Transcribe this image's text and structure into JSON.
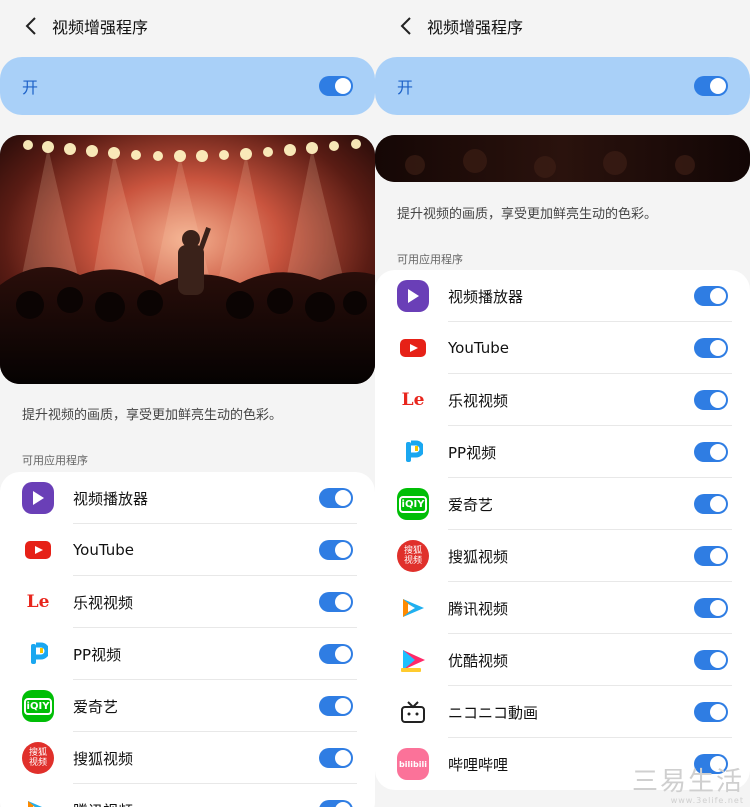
{
  "header": {
    "title": "视频增强程序"
  },
  "master": {
    "label": "开",
    "on": true
  },
  "description": "提升视频的画质，享受更加鲜亮生动的色彩。",
  "section_label": "可用应用程序",
  "colors": {
    "accent": "#2f7de3",
    "banner": "#a9d0f8",
    "banner_text": "#1e62c8"
  },
  "apps": [
    {
      "name": "视频播放器",
      "icon": "play-triangle-icon",
      "enabled": true
    },
    {
      "name": "YouTube",
      "icon": "youtube-icon",
      "enabled": true
    },
    {
      "name": "乐视视频",
      "icon": "letv-icon",
      "icon_text": "Le",
      "enabled": true
    },
    {
      "name": "PP视频",
      "icon": "pptv-icon",
      "enabled": true
    },
    {
      "name": "爱奇艺",
      "icon": "iqiyi-icon",
      "icon_text": "iQIY",
      "enabled": true
    },
    {
      "name": "搜狐视频",
      "icon": "sohu-icon",
      "icon_text": "搜狐视频",
      "enabled": true
    },
    {
      "name": "腾讯视频",
      "icon": "tencent-video-icon",
      "enabled": true
    },
    {
      "name": "优酷视频",
      "icon": "youku-icon",
      "enabled": true
    },
    {
      "name": "ニコニコ動画",
      "icon": "niconico-tv-icon",
      "enabled": true
    },
    {
      "name": "哔哩哔哩",
      "icon": "bilibili-icon",
      "icon_text": "bilibili",
      "enabled": true
    }
  ],
  "watermark": {
    "main": "三易生活",
    "url": "www.3elife.net"
  }
}
